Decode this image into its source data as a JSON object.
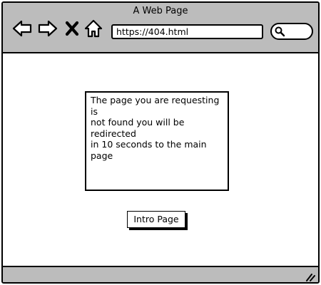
{
  "window": {
    "title": "A Web Page"
  },
  "toolbar": {
    "back_icon": "arrow-left-icon",
    "forward_icon": "arrow-right-icon",
    "stop_icon": "close-icon",
    "home_icon": "home-icon",
    "search_icon": "search-icon"
  },
  "address_bar": {
    "url": "https://404.html"
  },
  "main": {
    "message": "The page you are requesting is\nnot found you will be redirected\nin 10 seconds to the main page",
    "intro_button_label": "Intro Page"
  },
  "status_bar": {
    "grip_icon": "resize-grip-icon"
  },
  "colors": {
    "chrome": "#bcbcbc",
    "border": "#000000",
    "background": "#ffffff"
  }
}
